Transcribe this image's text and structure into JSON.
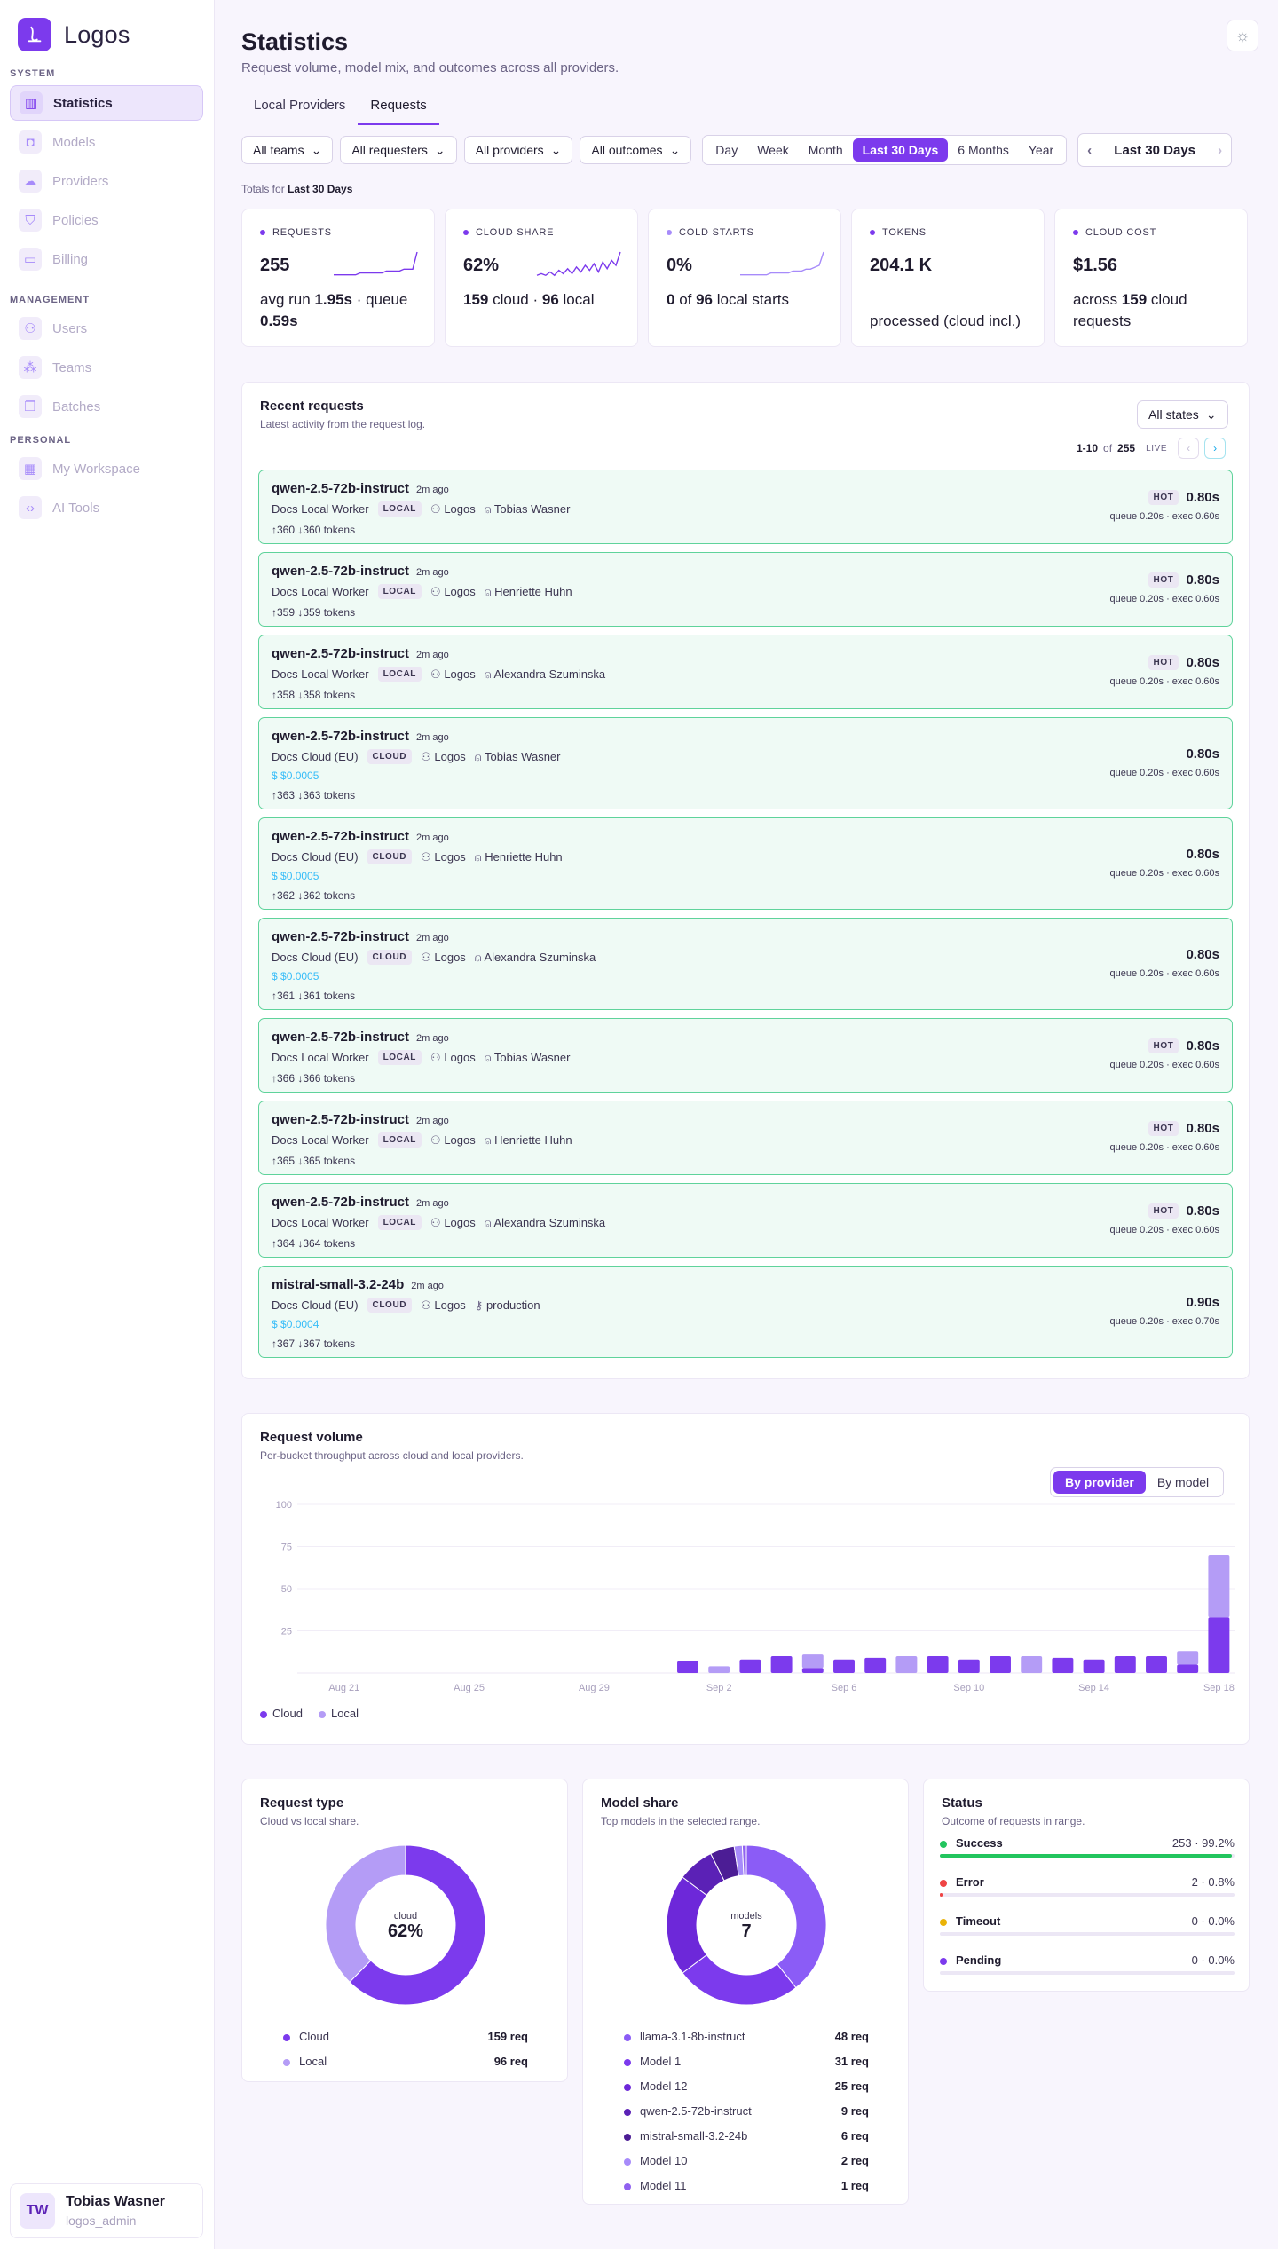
{
  "app": {
    "name": "Logos"
  },
  "sidebar": {
    "sections": [
      {
        "label": "SYSTEM",
        "items": [
          {
            "label": "Statistics",
            "icon": "chart-icon",
            "active": true
          },
          {
            "label": "Models",
            "icon": "cube-icon"
          },
          {
            "label": "Providers",
            "icon": "cloud-icon"
          },
          {
            "label": "Policies",
            "icon": "shield-icon"
          },
          {
            "label": "Billing",
            "icon": "card-icon"
          }
        ]
      },
      {
        "label": "MANAGEMENT",
        "items": [
          {
            "label": "Users",
            "icon": "users-icon"
          },
          {
            "label": "Teams",
            "icon": "teams-icon"
          },
          {
            "label": "Batches",
            "icon": "copy-icon"
          }
        ]
      },
      {
        "label": "PERSONAL",
        "items": [
          {
            "label": "My Workspace",
            "icon": "grid-icon"
          },
          {
            "label": "AI Tools",
            "icon": "code-icon"
          }
        ]
      }
    ],
    "user": {
      "initials": "TW",
      "name": "Tobias Wasner",
      "role": "logos_admin"
    }
  },
  "header": {
    "title": "Statistics",
    "subtitle": "Request volume, model mix, and outcomes across all providers."
  },
  "tabs": [
    {
      "label": "Local Providers",
      "active": false
    },
    {
      "label": "Requests",
      "active": true
    }
  ],
  "filters": {
    "teams": "All teams",
    "requesters": "All requesters",
    "providers": "All providers",
    "outcomes": "All outcomes"
  },
  "ranges": [
    "Day",
    "Week",
    "Month",
    "Last 30 Days",
    "6 Months",
    "Year"
  ],
  "active_range": "Last 30 Days",
  "range_nav": "Last 30 Days",
  "totals": {
    "prefix": "Totals for",
    "range": "Last 30 Days"
  },
  "kpis": [
    {
      "label": "REQUESTS",
      "value": "255",
      "sub_html": "avg run <b>1.95s</b> · queue <b>0.59s</b>",
      "color": "#7c3aed"
    },
    {
      "label": "CLOUD SHARE",
      "value": "62%",
      "sub_html": "<b>159</b> cloud · <b>96</b> local",
      "color": "#7c3aed"
    },
    {
      "label": "COLD STARTS",
      "value": "0%",
      "sub_html": "<b>0</b> of <b>96</b> local starts",
      "color": "#a78bfa"
    },
    {
      "label": "TOKENS",
      "value": "204.1 K",
      "sub_html": "<br>processed (cloud incl.)",
      "color": "#7c3aed"
    },
    {
      "label": "CLOUD COST",
      "value": "$1.56",
      "sub_html": "across <b>159</b> cloud requests",
      "color": "#7c3aed"
    }
  ],
  "recent": {
    "title": "Recent requests",
    "subtitle": "Latest activity from the request log.",
    "state_filter": "All states",
    "pager": {
      "range": "1-10",
      "of": "of",
      "total": "255",
      "live": "LIVE"
    },
    "rows": [
      {
        "model": "qwen-2.5-72b-instruct",
        "ago": "2m ago",
        "provider": "Docs Local Worker",
        "kind": "LOCAL",
        "team": "Logos",
        "user": "Tobias Wasner",
        "cost": "",
        "tokens": "↑360 ↓360 tokens",
        "hot": "HOT",
        "dur": "0.80s",
        "queue": "queue 0.20s · exec 0.60s"
      },
      {
        "model": "qwen-2.5-72b-instruct",
        "ago": "2m ago",
        "provider": "Docs Local Worker",
        "kind": "LOCAL",
        "team": "Logos",
        "user": "Henriette Huhn",
        "cost": "",
        "tokens": "↑359 ↓359 tokens",
        "hot": "HOT",
        "dur": "0.80s",
        "queue": "queue 0.20s · exec 0.60s"
      },
      {
        "model": "qwen-2.5-72b-instruct",
        "ago": "2m ago",
        "provider": "Docs Local Worker",
        "kind": "LOCAL",
        "team": "Logos",
        "user": "Alexandra Szuminska",
        "cost": "",
        "tokens": "↑358 ↓358 tokens",
        "hot": "HOT",
        "dur": "0.80s",
        "queue": "queue 0.20s · exec 0.60s"
      },
      {
        "model": "qwen-2.5-72b-instruct",
        "ago": "2m ago",
        "provider": "Docs Cloud (EU)",
        "kind": "CLOUD",
        "team": "Logos",
        "user": "Tobias Wasner",
        "cost": "$0.0005",
        "tokens": "↑363 ↓363 tokens",
        "hot": "",
        "dur": "0.80s",
        "queue": "queue 0.20s · exec 0.60s"
      },
      {
        "model": "qwen-2.5-72b-instruct",
        "ago": "2m ago",
        "provider": "Docs Cloud (EU)",
        "kind": "CLOUD",
        "team": "Logos",
        "user": "Henriette Huhn",
        "cost": "$0.0005",
        "tokens": "↑362 ↓362 tokens",
        "hot": "",
        "dur": "0.80s",
        "queue": "queue 0.20s · exec 0.60s"
      },
      {
        "model": "qwen-2.5-72b-instruct",
        "ago": "2m ago",
        "provider": "Docs Cloud (EU)",
        "kind": "CLOUD",
        "team": "Logos",
        "user": "Alexandra Szuminska",
        "cost": "$0.0005",
        "tokens": "↑361 ↓361 tokens",
        "hot": "",
        "dur": "0.80s",
        "queue": "queue 0.20s · exec 0.60s"
      },
      {
        "model": "qwen-2.5-72b-instruct",
        "ago": "2m ago",
        "provider": "Docs Local Worker",
        "kind": "LOCAL",
        "team": "Logos",
        "user": "Tobias Wasner",
        "cost": "",
        "tokens": "↑366 ↓366 tokens",
        "hot": "HOT",
        "dur": "0.80s",
        "queue": "queue 0.20s · exec 0.60s"
      },
      {
        "model": "qwen-2.5-72b-instruct",
        "ago": "2m ago",
        "provider": "Docs Local Worker",
        "kind": "LOCAL",
        "team": "Logos",
        "user": "Henriette Huhn",
        "cost": "",
        "tokens": "↑365 ↓365 tokens",
        "hot": "HOT",
        "dur": "0.80s",
        "queue": "queue 0.20s · exec 0.60s"
      },
      {
        "model": "qwen-2.5-72b-instruct",
        "ago": "2m ago",
        "provider": "Docs Local Worker",
        "kind": "LOCAL",
        "team": "Logos",
        "user": "Alexandra Szuminska",
        "cost": "",
        "tokens": "↑364 ↓364 tokens",
        "hot": "HOT",
        "dur": "0.80s",
        "queue": "queue 0.20s · exec 0.60s"
      },
      {
        "model": "mistral-small-3.2-24b",
        "ago": "2m ago",
        "provider": "Docs Cloud (EU)",
        "kind": "CLOUD",
        "team": "Logos",
        "user": "production",
        "user_icon": "key-icon",
        "cost": "$0.0004",
        "tokens": "↑367 ↓367 tokens",
        "hot": "",
        "dur": "0.90s",
        "queue": "queue 0.20s · exec 0.70s"
      }
    ]
  },
  "volume": {
    "title": "Request volume",
    "subtitle": "Per-bucket throughput across cloud and local providers.",
    "toggle": [
      "By provider",
      "By model"
    ],
    "active_toggle": "By provider"
  },
  "request_type": {
    "title": "Request type",
    "subtitle": "Cloud vs local share.",
    "center_label": "cloud",
    "center_value": "62%"
  },
  "model_share": {
    "title": "Model share",
    "subtitle": "Top models in the selected range.",
    "center_label": "models",
    "center_value": "7"
  },
  "status": {
    "title": "Status",
    "subtitle": "Outcome of requests in range.",
    "rows": [
      {
        "label": "Success",
        "value": "253 · 99.2%",
        "pct": 99.2,
        "color": "#22c55e"
      },
      {
        "label": "Error",
        "value": "2 · 0.8%",
        "pct": 0.8,
        "color": "#ef4444"
      },
      {
        "label": "Timeout",
        "value": "0 · 0.0%",
        "pct": 0,
        "color": "#eab308"
      },
      {
        "label": "Pending",
        "value": "0 · 0.0%",
        "pct": 0,
        "color": "#7c3aed"
      }
    ]
  },
  "chart_data": [
    {
      "type": "bar",
      "stacked": true,
      "title": "Request volume",
      "categories": [
        "Aug 20",
        "Aug 21",
        "Aug 22",
        "Aug 23",
        "Aug 24",
        "Aug 25",
        "Aug 26",
        "Aug 27",
        "Aug 28",
        "Aug 29",
        "Aug 30",
        "Aug 31",
        "Sep 1",
        "Sep 2",
        "Sep 3",
        "Sep 4",
        "Sep 5",
        "Sep 6",
        "Sep 7",
        "Sep 8",
        "Sep 9",
        "Sep 10",
        "Sep 11",
        "Sep 12",
        "Sep 13",
        "Sep 14",
        "Sep 15",
        "Sep 16",
        "Sep 17",
        "Sep 18"
      ],
      "tick_labels": [
        "Aug 21",
        "Aug 25",
        "Aug 29",
        "Sep 2",
        "Sep 6",
        "Sep 10",
        "Sep 14",
        "Sep 18"
      ],
      "series": [
        {
          "name": "Cloud",
          "color": "#7c3aed",
          "values": [
            0,
            0,
            0,
            0,
            0,
            0,
            0,
            0,
            0,
            0,
            0,
            0,
            7,
            0,
            8,
            10,
            3,
            8,
            9,
            0,
            10,
            8,
            10,
            0,
            9,
            8,
            10,
            10,
            5,
            33
          ]
        },
        {
          "name": "Local",
          "color": "#b49cf6",
          "values": [
            0,
            0,
            0,
            0,
            0,
            0,
            0,
            0,
            0,
            0,
            0,
            0,
            0,
            4,
            0,
            0,
            8,
            0,
            0,
            10,
            0,
            0,
            0,
            10,
            0,
            0,
            0,
            0,
            8,
            37
          ]
        }
      ],
      "ylim": [
        0,
        100
      ],
      "yticks": [
        25,
        50,
        75,
        100
      ],
      "legend": "bottom-left"
    },
    {
      "type": "pie",
      "donut": true,
      "title": "Request type",
      "slices": [
        {
          "label": "Cloud",
          "value": 159,
          "display": "159 req",
          "color": "#7c3aed"
        },
        {
          "label": "Local",
          "value": 96,
          "display": "96 req",
          "color": "#b49cf6"
        }
      ]
    },
    {
      "type": "pie",
      "donut": true,
      "title": "Model share",
      "slices": [
        {
          "label": "llama-3.1-8b-instruct",
          "value": 48,
          "display": "48 req",
          "color": "#8b5cf6"
        },
        {
          "label": "Model 1",
          "value": 31,
          "display": "31 req",
          "color": "#7c3aed"
        },
        {
          "label": "Model 12",
          "value": 25,
          "display": "25 req",
          "color": "#6d28d9"
        },
        {
          "label": "qwen-2.5-72b-instruct",
          "value": 9,
          "display": "9 req",
          "color": "#5b21b6"
        },
        {
          "label": "mistral-small-3.2-24b",
          "value": 6,
          "display": "6 req",
          "color": "#4c1d95"
        },
        {
          "label": "Model 10",
          "value": 2,
          "display": "2 req",
          "color": "#a78bfa"
        },
        {
          "label": "Model 11",
          "value": 1,
          "display": "1 req",
          "color": "#9061f0"
        }
      ]
    }
  ],
  "sparklines": {
    "requests": [
      2,
      2,
      2,
      2,
      2,
      2,
      3,
      3,
      3,
      3,
      3,
      3,
      4,
      4,
      4,
      4,
      5,
      5,
      5,
      14
    ],
    "cloud_share": [
      2,
      3,
      2,
      4,
      2,
      5,
      3,
      6,
      3,
      7,
      4,
      8,
      5,
      9,
      4,
      10,
      6,
      11,
      8,
      16
    ],
    "cold_starts": [
      2,
      2,
      2,
      2,
      2,
      2,
      2,
      3,
      3,
      3,
      3,
      3,
      4,
      4,
      4,
      5,
      5,
      6,
      7,
      14
    ]
  }
}
